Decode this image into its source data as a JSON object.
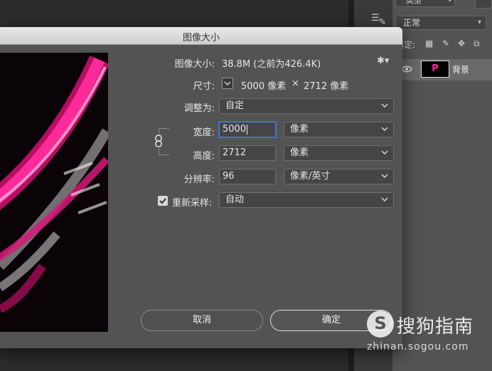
{
  "dialog": {
    "title": "图像大小",
    "image_size_label": "图像大小:",
    "image_size_value": "38.8M (之前为426.4K)",
    "dimensions_label": "尺寸:",
    "dimensions_width": "5000 像素",
    "dimensions_times": "×",
    "dimensions_height": "2712 像素",
    "fit_to_label": "调整为:",
    "fit_to_value": "自定",
    "width_label": "宽度:",
    "width_value": "5000",
    "width_unit": "像素",
    "height_label": "高度:",
    "height_value": "2712",
    "height_unit": "像素",
    "resolution_label": "分辨率:",
    "resolution_value": "96",
    "resolution_unit": "像素/英寸",
    "resample_label": "重新采样:",
    "resample_checked": true,
    "resample_value": "自动",
    "cancel_label": "取消",
    "ok_label": "确定"
  },
  "layers_panel": {
    "kind_filter": "类型",
    "blend_mode": "正常",
    "lock_label": "锁定:",
    "layer_name": "背景",
    "layer_thumb_letter": "P"
  },
  "watermark": {
    "logo_letter": "S",
    "brand": "搜狗指南",
    "url": "zhinan.sogou.com"
  },
  "colors": {
    "focus_blue": "#4a7fd1",
    "preview_magenta": "#e0137a",
    "dialog_bg": "#535353"
  }
}
